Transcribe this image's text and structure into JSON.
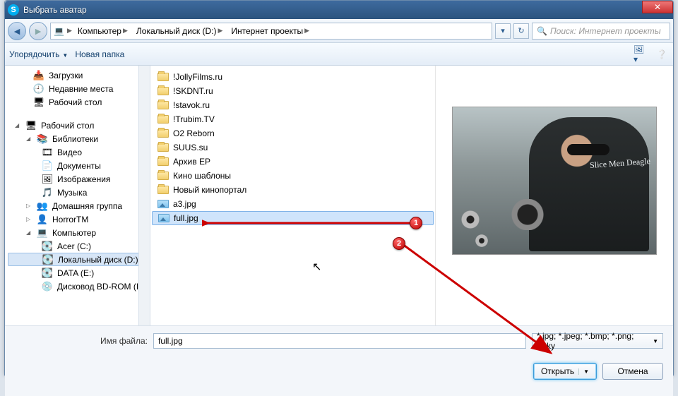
{
  "title": "Выбрать аватар",
  "breadcrumbs": [
    "Компьютер",
    "Локальный диск (D:)",
    "Интернет проекты"
  ],
  "search_placeholder": "Поиск: Интернет проекты",
  "toolbar": {
    "organize": "Упорядочить",
    "new_folder": "Новая папка"
  },
  "sidebar": {
    "quick": [
      {
        "label": "Загрузки",
        "icon": "📥"
      },
      {
        "label": "Недавние места",
        "icon": "🕘"
      },
      {
        "label": "Рабочий стол",
        "icon": "🖥"
      }
    ],
    "desktop_header": "Рабочий стол",
    "libraries_header": "Библиотеки",
    "libraries": [
      {
        "label": "Видео",
        "icon": "🎞"
      },
      {
        "label": "Документы",
        "icon": "📄"
      },
      {
        "label": "Изображения",
        "icon": "🖼"
      },
      {
        "label": "Музыка",
        "icon": "🎵"
      }
    ],
    "others": [
      {
        "label": "Домашняя группа",
        "icon": "👥"
      },
      {
        "label": "HorrorTM",
        "icon": "👤"
      },
      {
        "label": "Компьютер",
        "icon": "💻"
      }
    ],
    "drives": [
      {
        "label": "Acer (C:)",
        "icon": "💽"
      },
      {
        "label": "Локальный диск (D:)",
        "icon": "💽",
        "selected": true
      },
      {
        "label": "DATA (E:)",
        "icon": "💽"
      },
      {
        "label": "Дисковод BD-ROM (I",
        "icon": "💿"
      }
    ]
  },
  "files": [
    {
      "name": "!JollyFilms.ru",
      "type": "folder"
    },
    {
      "name": "!SKDNT.ru",
      "type": "folder"
    },
    {
      "name": "!stavok.ru",
      "type": "folder"
    },
    {
      "name": "!Trubim.TV",
      "type": "folder"
    },
    {
      "name": "O2 Reborn",
      "type": "folder"
    },
    {
      "name": "SUUS.su",
      "type": "folder"
    },
    {
      "name": "Архив ЕР",
      "type": "folder"
    },
    {
      "name": "Кино шаблоны",
      "type": "folder"
    },
    {
      "name": "Новый кинопортал",
      "type": "folder"
    },
    {
      "name": "a3.jpg",
      "type": "image"
    },
    {
      "name": "full.jpg",
      "type": "image",
      "selected": true
    }
  ],
  "preview_overlay_text": "Slice Men Deagle",
  "filename_label": "Имя файла:",
  "filename_value": "full.jpg",
  "filter_value": "*.jpg; *.jpeg; *.bmp; *.png; *.sky",
  "buttons": {
    "open": "Открыть",
    "cancel": "Отмена"
  },
  "annotations": {
    "marker1": "1",
    "marker2": "2"
  }
}
